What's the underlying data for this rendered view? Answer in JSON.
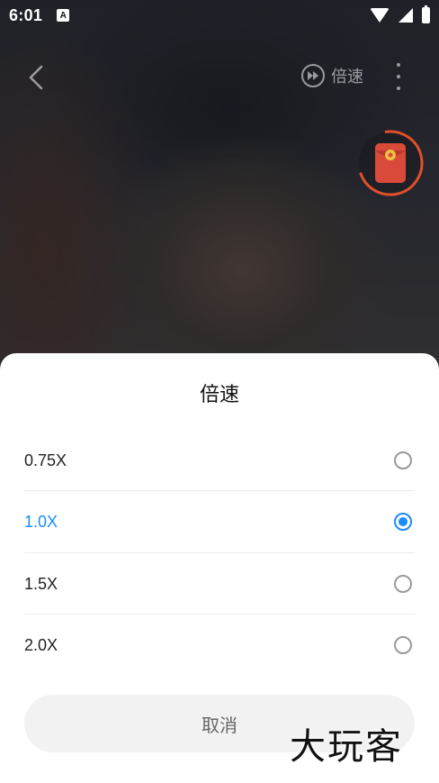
{
  "statusbar": {
    "time": "6:01",
    "notif_icon": "A"
  },
  "topbar": {
    "speed_label": "倍速"
  },
  "sheet": {
    "title": "倍速",
    "options": [
      {
        "label": "0.75X",
        "selected": false
      },
      {
        "label": "1.0X",
        "selected": true
      },
      {
        "label": "1.5X",
        "selected": false
      },
      {
        "label": "2.0X",
        "selected": false
      }
    ],
    "cancel_label": "取消"
  },
  "watermark": "大玩客",
  "colors": {
    "accent": "#1a8cff",
    "sheet_bg": "#ffffff",
    "cancel_bg": "#f2f2f2",
    "redpacket": "#d94a3a",
    "ring": "#e0502a"
  }
}
